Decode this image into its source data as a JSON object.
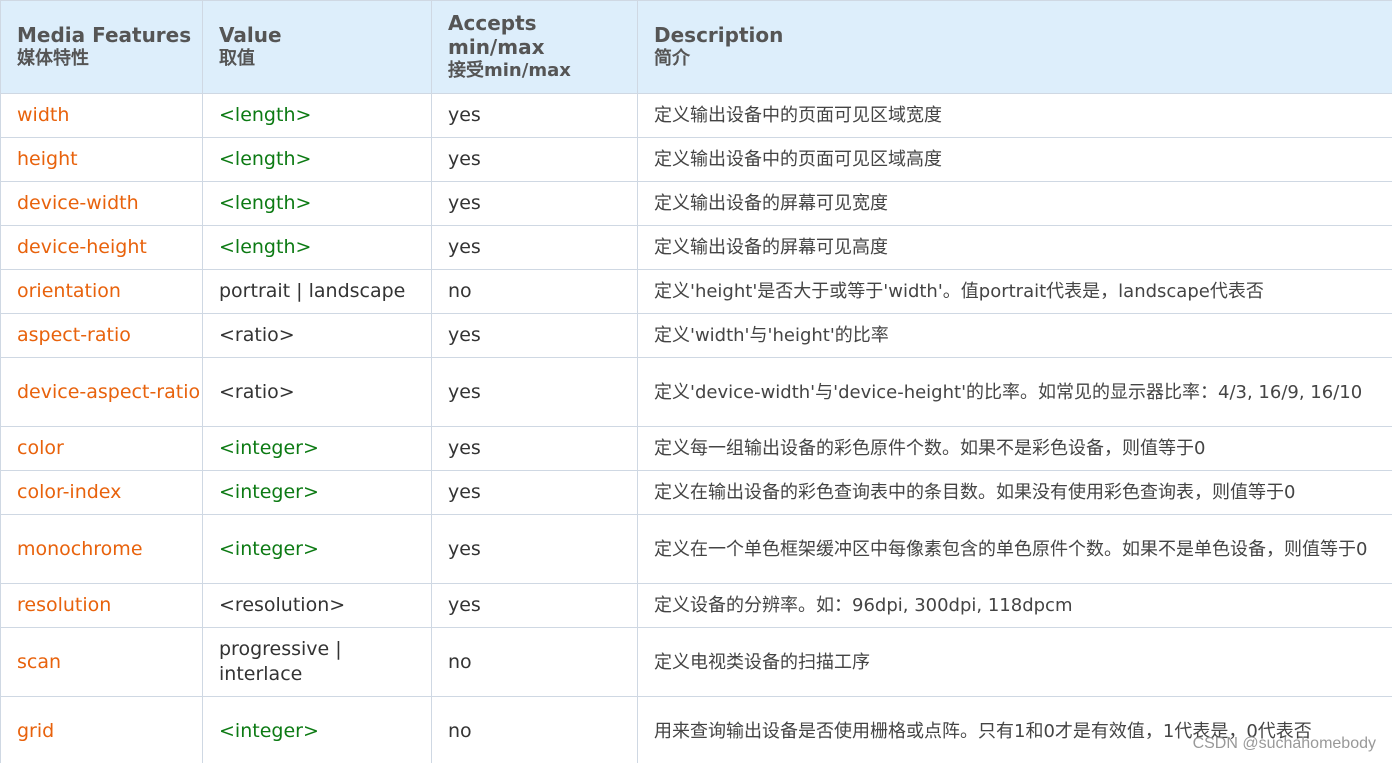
{
  "header": {
    "feature": {
      "title": "Media Features",
      "sub": "媒体特性"
    },
    "value": {
      "title": "Value",
      "sub": "取值"
    },
    "accepts": {
      "title": "Accepts min/max",
      "sub": "接受min/max"
    },
    "description": {
      "title": "Description",
      "sub": "简介"
    }
  },
  "rows": [
    {
      "feature": "width",
      "value": "<length>",
      "value_style": "green",
      "accepts": "yes",
      "description": "定义输出设备中的页面可见区域宽度"
    },
    {
      "feature": "height",
      "value": "<length>",
      "value_style": "green",
      "accepts": "yes",
      "description": "定义输出设备中的页面可见区域高度"
    },
    {
      "feature": "device-width",
      "value": "<length>",
      "value_style": "green",
      "accepts": "yes",
      "description": "定义输出设备的屏幕可见宽度"
    },
    {
      "feature": "device-height",
      "value": "<length>",
      "value_style": "green",
      "accepts": "yes",
      "description": "定义输出设备的屏幕可见高度"
    },
    {
      "feature": "orientation",
      "value": "portrait | landscape",
      "value_style": "plain",
      "accepts": "no",
      "description": "定义'height'是否大于或等于'width'。值portrait代表是，landscape代表否"
    },
    {
      "feature": "aspect-ratio",
      "value": "<ratio>",
      "value_style": "plain",
      "accepts": "yes",
      "description": "定义'width'与'height'的比率"
    },
    {
      "feature": "device-aspect-ratio",
      "value": "<ratio>",
      "value_style": "plain",
      "accepts": "yes",
      "description": "定义'device-width'与'device-height'的比率。如常见的显示器比率：4/3, 16/9, 16/10",
      "tall": true
    },
    {
      "feature": "color",
      "value": "<integer>",
      "value_style": "green",
      "accepts": "yes",
      "description": "定义每一组输出设备的彩色原件个数。如果不是彩色设备，则值等于0"
    },
    {
      "feature": "color-index",
      "value": "<integer>",
      "value_style": "green",
      "accepts": "yes",
      "description": "定义在输出设备的彩色查询表中的条目数。如果没有使用彩色查询表，则值等于0"
    },
    {
      "feature": "monochrome",
      "value": "<integer>",
      "value_style": "green",
      "accepts": "yes",
      "description": "定义在一个单色框架缓冲区中每像素包含的单色原件个数。如果不是单色设备，则值等于0",
      "tall": true
    },
    {
      "feature": "resolution",
      "value": "<resolution>",
      "value_style": "plain",
      "accepts": "yes",
      "description": "定义设备的分辨率。如：96dpi, 300dpi, 118dpcm"
    },
    {
      "feature": "scan",
      "value": "progressive | interlace",
      "value_style": "plain",
      "accepts": "no",
      "description": "定义电视类设备的扫描工序",
      "tall": true
    },
    {
      "feature": "grid",
      "value": "<integer>",
      "value_style": "green",
      "accepts": "no",
      "description": "用来查询输出设备是否使用栅格或点阵。只有1和0才是有效值，1代表是，0代表否",
      "tall": true
    }
  ],
  "watermark": "CSDN @suchahomebody",
  "colors": {
    "header_bg": "#ddeefb",
    "feature_text": "#e8620c",
    "value_green": "#0c7a13",
    "border": "#cfd8e3"
  }
}
